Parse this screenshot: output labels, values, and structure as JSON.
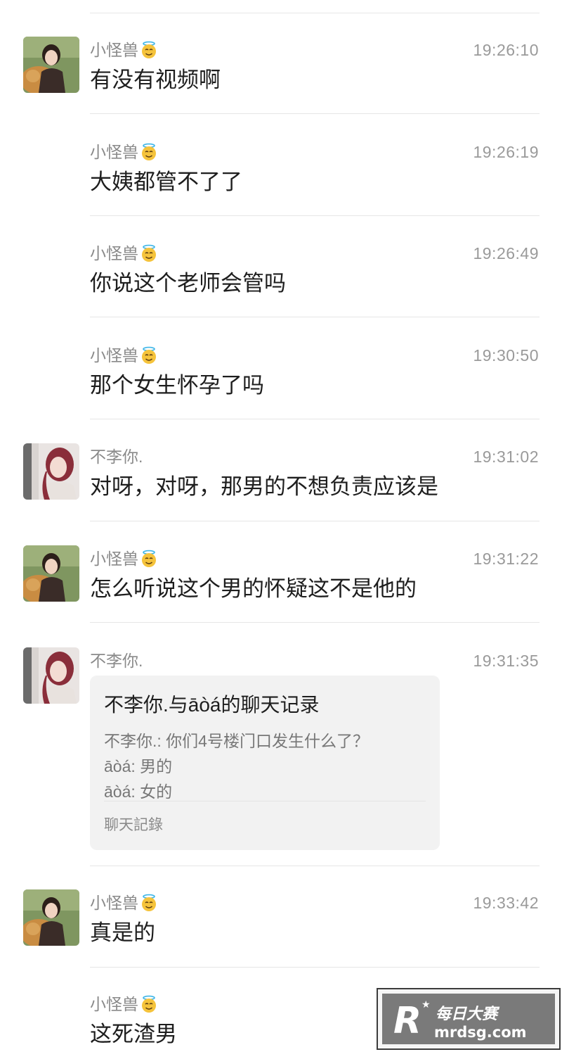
{
  "messages": [
    {
      "sender": "小怪兽",
      "badge": "angel-emoji",
      "time": "19:26:10",
      "text": "有没有视频啊",
      "avatar": "girl-with-dog"
    },
    {
      "sender": "小怪兽",
      "badge": "angel-emoji",
      "time": "19:26:19",
      "text": "大姨都管不了了"
    },
    {
      "sender": "小怪兽",
      "badge": "angel-emoji",
      "time": "19:26:49",
      "text": "你说这个老师会管吗"
    },
    {
      "sender": "小怪兽",
      "badge": "angel-emoji",
      "time": "19:30:50",
      "text": "那个女生怀孕了吗"
    },
    {
      "sender": "不李你.",
      "time": "19:31:02",
      "text": "对呀，对呀，那男的不想负责应该是",
      "avatar": "girl-pink-hair"
    },
    {
      "sender": "小怪兽",
      "badge": "angel-emoji",
      "time": "19:31:22",
      "text": "怎么听说这个男的怀疑这不是他的",
      "avatar": "girl-with-dog"
    },
    {
      "sender": "不李你.",
      "time": "19:31:35",
      "avatar": "girl-pink-hair",
      "record": {
        "title": "不李你.与āòá的聊天记录",
        "lines": [
          "不李你.: 你们4号楼门口发生什么了？",
          "āòá: 男的",
          "āòá: 女的"
        ],
        "footer": "聊天記錄"
      }
    },
    {
      "sender": "小怪兽",
      "badge": "angel-emoji",
      "time": "19:33:42",
      "text": "真是的",
      "avatar": "girl-with-dog"
    },
    {
      "sender": "小怪兽",
      "badge": "angel-emoji",
      "text": "这死渣男"
    }
  ],
  "watermark": {
    "site_name": "每日大赛",
    "domain": "mrdsg.com",
    "logo_letter": "R"
  },
  "colors": {
    "background": "#ffffff",
    "divider": "#e6e6e6",
    "sender": "#8a8a8a",
    "record_bg": "#f2f2f2"
  }
}
